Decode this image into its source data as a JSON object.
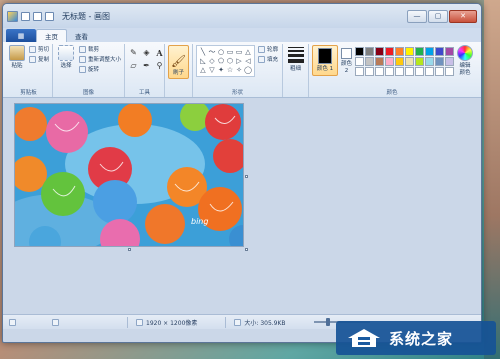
{
  "window": {
    "title": "无标题 - 画图"
  },
  "tabs": {
    "file_icon": "▦",
    "home": "主页",
    "view": "查看"
  },
  "ribbon": {
    "clipboard": {
      "paste": "粘贴",
      "cut": "剪切",
      "copy": "复制",
      "label": "剪贴板"
    },
    "image": {
      "select": "选择",
      "crop": "裁剪",
      "resize": "重新调整大小",
      "rotate": "旋转",
      "label": "图像"
    },
    "tools": {
      "label": "工具"
    },
    "brush": {
      "label": "刷子"
    },
    "shapes": {
      "outline": "轮廓",
      "fill": "填充",
      "label": "形状",
      "glyphs": [
        "╲",
        "〜",
        "○",
        "▭",
        "▭",
        "△",
        "◺",
        "◇",
        "⬠",
        "⬡",
        "▷",
        "◁",
        "△",
        "▽",
        "✦",
        "☆",
        "✧",
        "◯"
      ]
    },
    "size": {
      "label": "粗细"
    },
    "colors": {
      "color1": "颜色 1",
      "color2": "颜色 2",
      "edit": "编辑颜色",
      "label": "颜色",
      "color1_value": "#000000",
      "color2_value": "#ffffff",
      "palette": [
        "#000000",
        "#7f7f7f",
        "#880015",
        "#ed1c24",
        "#ff7f27",
        "#fff200",
        "#22b14c",
        "#00a2e8",
        "#3f48cc",
        "#a349a4",
        "#ffffff",
        "#c3c3c3",
        "#b97a57",
        "#ffaec9",
        "#ffc90e",
        "#efe4b0",
        "#b5e61d",
        "#99d9ea",
        "#7092be",
        "#c8bfe7",
        "#ffffff",
        "#ffffff",
        "#ffffff",
        "#ffffff",
        "#ffffff",
        "#ffffff",
        "#ffffff",
        "#ffffff",
        "#ffffff",
        "#ffffff"
      ]
    }
  },
  "canvas": {
    "bing_text": "bing"
  },
  "status": {
    "dimensions": "1920 × 1200像素",
    "size": "大小: 305.9KB"
  },
  "watermark": {
    "text": "系统之家"
  }
}
